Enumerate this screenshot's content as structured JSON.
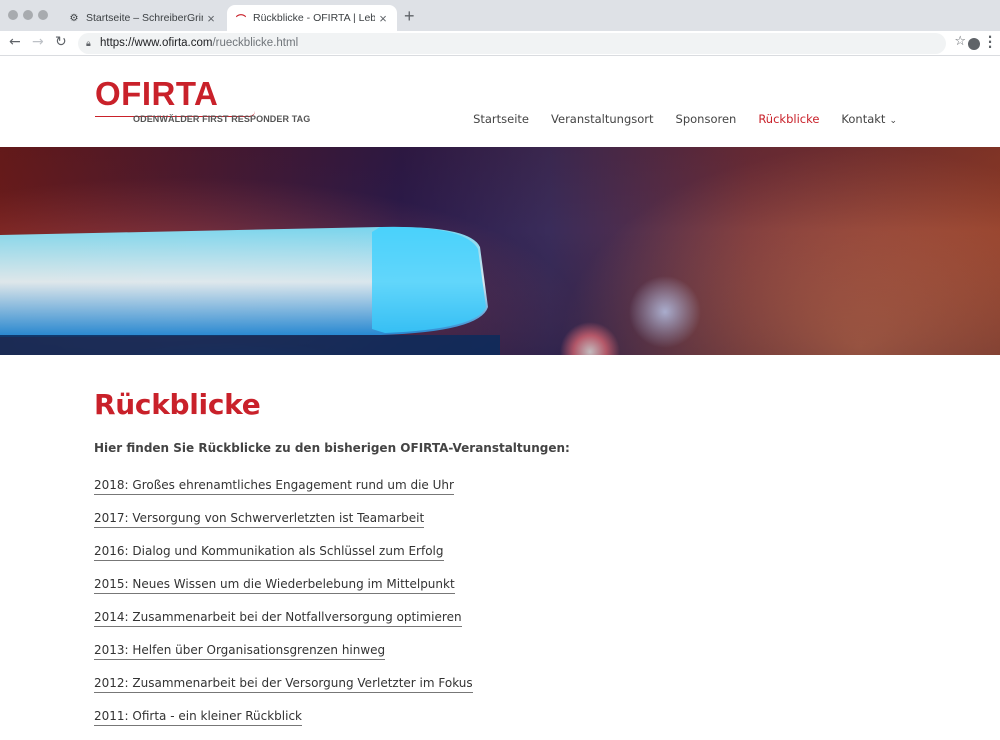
{
  "browser": {
    "tabs": [
      {
        "title": "Startseite – SchreiberGrimm – W",
        "active": false
      },
      {
        "title": "Rückblicke - OFIRTA | Leben, R",
        "active": true
      }
    ],
    "url_host": "https://www.ofirta.com",
    "url_path": "/rueckblicke.html"
  },
  "logo": {
    "main": "OFIRTA",
    "sub": "ODENWÄLDER FIRST RESPONDER TAG"
  },
  "nav": {
    "items": [
      {
        "label": "Startseite"
      },
      {
        "label": "Veranstaltungsort"
      },
      {
        "label": "Sponsoren"
      },
      {
        "label": "Rückblicke",
        "active": true
      },
      {
        "label": "Kontakt",
        "has_dropdown": true
      }
    ]
  },
  "content": {
    "title": "Rückblicke",
    "intro": "Hier finden Sie Rückblicke zu den bisherigen OFIRTA-Veranstaltungen:",
    "links": [
      "2018: Großes ehrenamtliches Engagement rund um die Uhr",
      "2017: Versorgung von Schwerverletzten ist Teamarbeit",
      "2016: Dialog und Kommunikation als Schlüssel zum Erfolg",
      "2015: Neues Wissen um die Wiederbelebung im Mittelpunkt",
      "2014: Zusammenarbeit bei der Notfallversorgung optimieren",
      "2013: Helfen über Organisationsgrenzen hinweg",
      "2012: Zusammenarbeit bei der Versorgung Verletzter im Fokus",
      "2011: Ofirta - ein kleiner Rückblick"
    ]
  },
  "colors": {
    "brand_red": "#c9212a",
    "text": "#444444"
  }
}
